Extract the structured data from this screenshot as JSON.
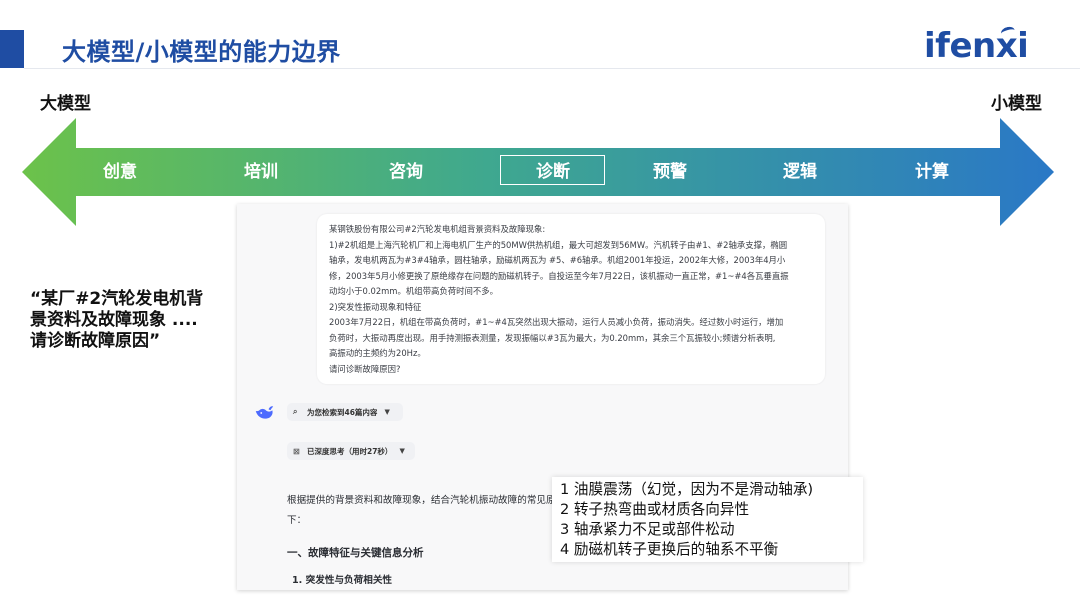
{
  "slide": {
    "title": "大模型/小模型的能力边界",
    "logo": "ifenxi"
  },
  "spectrum": {
    "left_label": "大模型",
    "right_label": "小模型",
    "stages": [
      "创意",
      "培训",
      "咨询",
      "诊断",
      "预警",
      "逻辑",
      "计算"
    ],
    "highlighted_stage": "诊断",
    "gradient_colors": [
      "#6cc24a",
      "#2a78c6"
    ]
  },
  "prompt_quote": [
    "“某厂#2汽轮发电机背",
    "景资料及故障现象 ....",
    "请诊断故障原因”"
  ],
  "chat": {
    "user_message": [
      "某钢铁股份有限公司#2汽轮发电机组背景资料及故障现象:",
      "1)#2机组是上海汽轮机厂和上海电机厂生产的50MW供热机组，最大可超发到56MW。汽机转子由#1、#2轴承支撑，椭圆",
      "轴承，发电机两瓦为#3#4轴承，圆柱轴承，励磁机两瓦为 #5、#6轴承。机组2001年投运，2002年大修，2003年4月小",
      "修，2003年5月小修更换了原绝缘存在问题的励磁机转子。自投运至今年7月22日，该机振动一直正常，#1~#4各瓦垂直振",
      "动均小于0.02mm。机组带高负荷时间不多。",
      "2)突发性振动现象和特征",
      "2003年7月22日，机组在带高负荷时，#1~#4瓦突然出现大振动，运行人员减小负荷，振动消失。经过数小时运行，增加",
      "负荷时，大振动再度出现。用手持测振表测量，发现振幅以#3瓦为最大，为0.20mm，其余三个瓦振较小;频谱分析表明,",
      "高振动的主频约为20Hz。",
      "请问诊断故障原因?"
    ],
    "search_pill": "为您检索到46篇内容",
    "think_pill": "已深度思考（用时27秒）",
    "answer_intro": "根据提供的背景资料和故障现象，结合汽轮机振动故障的常见原因如下：",
    "answer_heading": "一、故障特征与关键信息分析",
    "answer_subheading": "1. 突发性与负荷相关性"
  },
  "callout": {
    "lines": [
      "1 油膜震荡（幻觉，因为不是滑动轴承)",
      "2 转子热弯曲或材质各向异性",
      "3 轴承紧力不足或部件松动",
      "4 励磁机转子更换后的轴系不平衡"
    ]
  }
}
